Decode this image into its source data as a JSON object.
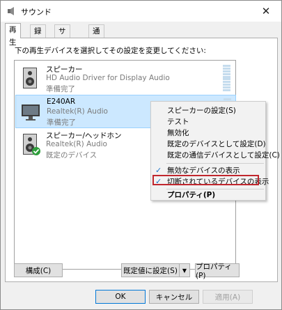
{
  "window": {
    "title": "サウンド",
    "close_glyph": "✕"
  },
  "tabs": [
    "再生",
    "録音",
    "サウンド",
    "通信"
  ],
  "instruction": "下の再生デバイスを選択してその設定を変更してください:",
  "devices": [
    {
      "name": "スピーカー",
      "description": "HD Audio Driver for Display Audio",
      "status": "準備完了",
      "icon": "speaker-icon"
    },
    {
      "name": "E240AR",
      "description": "Realtek(R) Audio",
      "status": "準備完了",
      "icon": "monitor-icon",
      "selected": true
    },
    {
      "name": "スピーカー/ヘッドホン",
      "description": "Realtek(R) Audio",
      "status": "既定のデバイス",
      "icon": "speaker-icon",
      "default_badge": true
    }
  ],
  "context_menu": {
    "items": [
      {
        "label": "スピーカーの設定(S)"
      },
      {
        "label": "テスト"
      },
      {
        "label": "無効化"
      },
      {
        "label": "既定のデバイスとして設定(D)"
      },
      {
        "label": "既定の通信デバイスとして設定(C)"
      },
      {
        "label": "無効なデバイスの表示",
        "checked": true
      },
      {
        "label": "切断されているデバイスの表示",
        "checked": true,
        "highlighted": true
      },
      {
        "label": "プロパティ(P)",
        "bold": true
      }
    ],
    "check_glyph": "✓",
    "highlight_color": "#c0262d"
  },
  "buttons": {
    "configure": "構成(C)",
    "set_default": "既定値に設定(S)",
    "properties": "プロパティ(P)",
    "ok": "OK",
    "cancel": "キャンセル",
    "apply": "適用(A)"
  },
  "colors": {
    "selection_bg": "#cce8ff",
    "selection_border": "#99d1ff",
    "default_badge": "#2e9e3b",
    "check": "#1a73c9"
  }
}
